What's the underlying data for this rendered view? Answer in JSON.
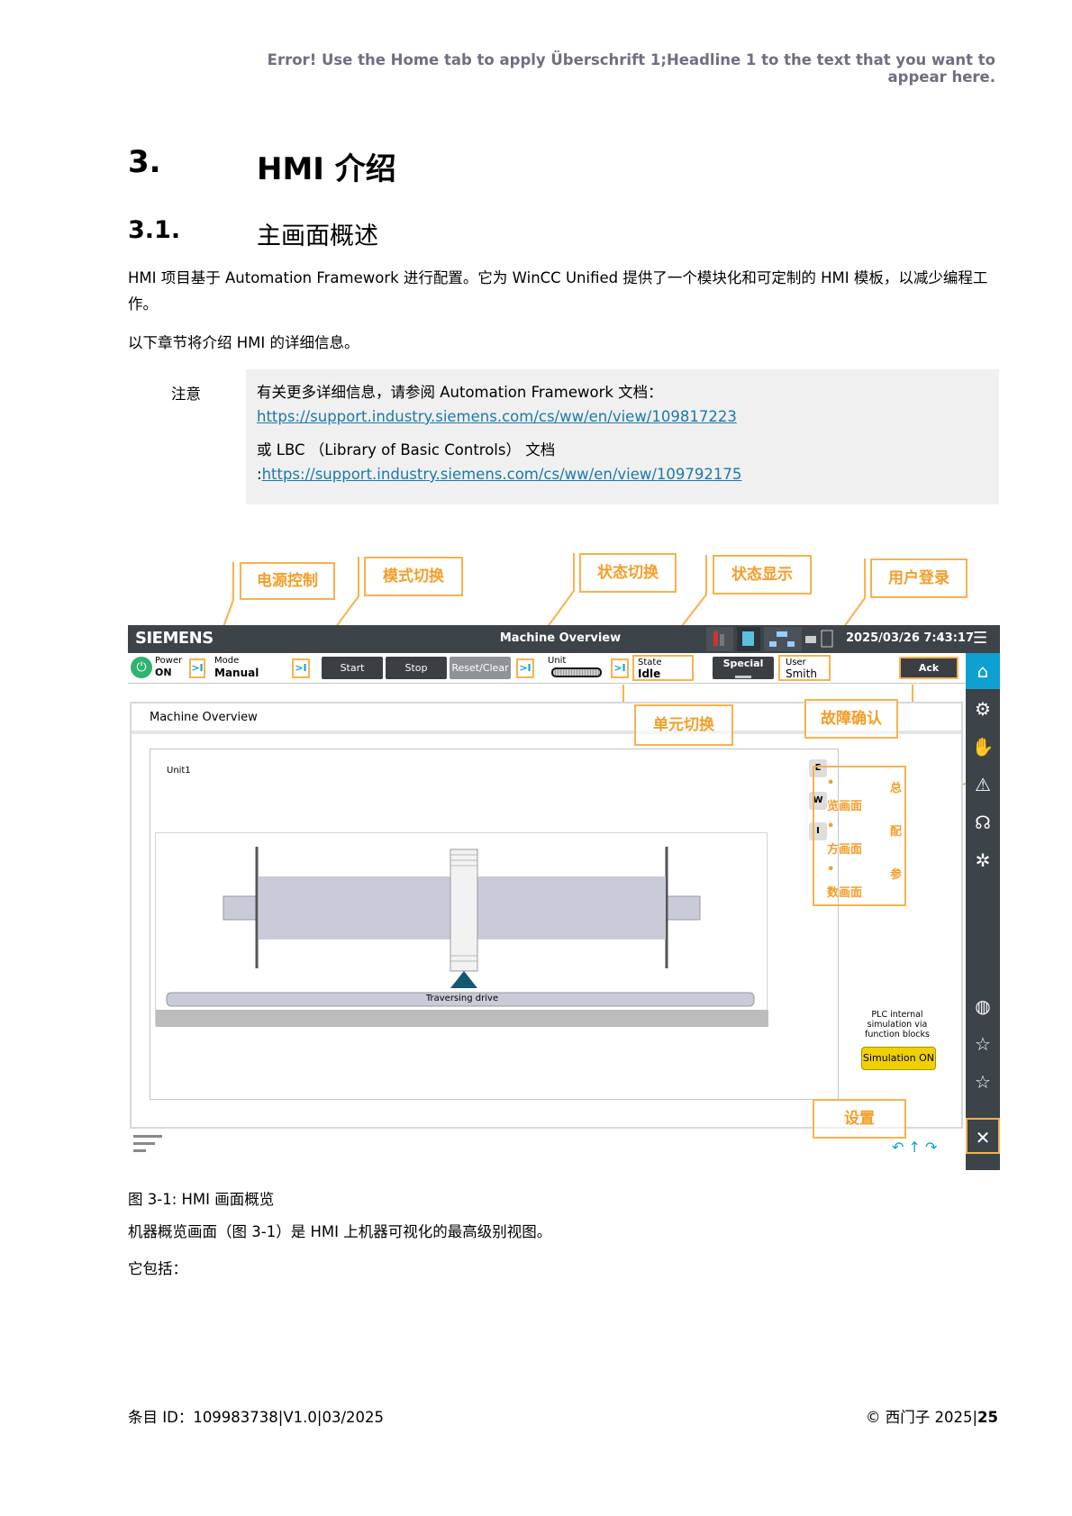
{
  "header_note": "Error! Use the Home tab to apply Überschrift 1;Headline 1 to the text that you want to appear here.",
  "h1": {
    "num": "3.",
    "title": "HMI 介绍"
  },
  "h2": {
    "num": "3.1.",
    "title": "主画面概述"
  },
  "para1": "HMI 项目基于 Automation Framework 进行配置。它为 WinCC Unified 提供了一个模块化和可定制的 HMI 模板，以减少编程工作。",
  "para2": "以下章节将介绍 HMI 的详细信息。",
  "note": {
    "label": "注意",
    "line1": "有关更多详细信息，请参阅 Automation Framework 文档：",
    "link1": "https://support.industry.siemens.com/cs/ww/en/view/109817223",
    "line2": "或 LBC （Library of Basic Controls） 文档",
    "link2_prefix": ":",
    "link2": "https://support.industry.siemens.com/cs/ww/en/view/109792175"
  },
  "hmi": {
    "logo": "SIEMENS",
    "title": "Machine Overview",
    "datetime": "2025/03/26  7:43:17",
    "power_label": "Power",
    "power_value": "ON",
    "mode_label": "Mode",
    "mode_value": "Manual",
    "start": "Start",
    "stop": "Stop",
    "reset": "Reset/Clear",
    "unit_label": "Unit",
    "state_label": "State",
    "state_value": "Idle",
    "special": "Special",
    "user_label": "User",
    "user_value": "Smith",
    "ack": "Ack",
    "screen_title": "Machine Overview",
    "unit_name": "Unit1",
    "side_e": "E",
    "side_w": "W",
    "side_i": "I",
    "traversing": "Traversing drive",
    "plc_note1": "PLC internal",
    "plc_note2": "simulation via",
    "plc_note3": "function blocks",
    "simulation": "Simulation ON"
  },
  "annotations": {
    "power": "电源控制",
    "mode": "模式切换",
    "state_switch": "状态切换",
    "state_show": "状态显示",
    "login": "用户登录",
    "unit_switch": "单元切换",
    "fault_ack": "故障确认",
    "overview_a": "览画面",
    "overview_b": "方画面",
    "overview_c": "数画面",
    "side_1": "总",
    "side_2": "配",
    "side_3": "参",
    "settings": "设置"
  },
  "caption": "图 3-1: HMI 画面概览",
  "para3": "机器概览画面（图 3-1）是 HMI 上机器可视化的最高级别视图。",
  "para4": "它包括：",
  "footer_left": "条目 ID：109983738|V1.0|03/2025",
  "footer_right_prefix": "© 西门子 2025|",
  "footer_page": "25",
  "colors": {
    "accent": "#f7b24d",
    "bar": "#3c4349",
    "home": "#0fa0d2",
    "sim": "#f0d000"
  }
}
